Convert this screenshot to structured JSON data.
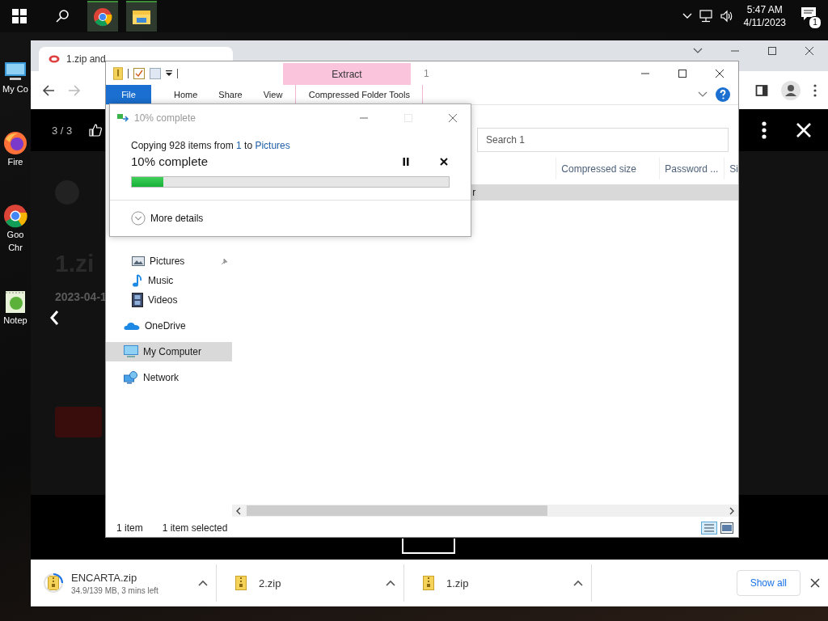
{
  "taskbar": {
    "time": "5:47 AM",
    "date": "4/11/2023",
    "notification_count": "1"
  },
  "desktop_icons": [
    {
      "kind": "computer",
      "label_lines": [
        "My Co"
      ]
    },
    {
      "kind": "firefox",
      "label_lines": [
        "Fire"
      ]
    },
    {
      "kind": "chrome",
      "label_lines": [
        "Goo",
        "Chr"
      ]
    },
    {
      "kind": "notepad",
      "label_lines": [
        "Notep"
      ]
    }
  ],
  "browser": {
    "tab_title": "1.zip and",
    "page": {
      "counter": "3 / 3",
      "title": "1.zi",
      "date": "2023-04-1"
    },
    "downloads": [
      {
        "name": "ENCARTA.zip",
        "status": "34.9/139 MB, 3 mins left",
        "level": 0.25
      },
      {
        "name": "2.zip"
      },
      {
        "name": "1.zip"
      }
    ],
    "show_all": "Show all"
  },
  "explorer": {
    "context_group": "Extract",
    "title": "1",
    "ribbon_tabs": [
      {
        "label": "File",
        "kind": "file"
      },
      {
        "label": "Home",
        "kind": "tab"
      },
      {
        "label": "Share",
        "kind": "tab"
      },
      {
        "label": "View",
        "kind": "tab"
      },
      {
        "label": "Compressed Folder Tools",
        "kind": "context"
      }
    ],
    "search": {
      "placeholder": "Search 1"
    },
    "columns": [
      "Compressed size",
      "Password ...",
      "Si"
    ],
    "rows": [
      {
        "name": "r",
        "selected": true
      }
    ],
    "quick_access": [
      {
        "label": "Pictures",
        "kind": "pictures",
        "pinned": true
      },
      {
        "label": "Music",
        "kind": "music",
        "pinned": false
      },
      {
        "label": "Videos",
        "kind": "videos",
        "pinned": false
      }
    ],
    "locations": [
      {
        "label": "OneDrive",
        "kind": "cloud",
        "selected": false
      },
      {
        "label": "My Computer",
        "kind": "computer",
        "selected": true
      },
      {
        "label": "Network",
        "kind": "network",
        "selected": false
      }
    ],
    "status": {
      "count": "1 item",
      "selection": "1 item selected"
    }
  },
  "copy_dialog": {
    "title": "10% complete",
    "message": {
      "prefix": "Copying 928 items from",
      "source": "1",
      "middle": "to",
      "destination": "Pictures"
    },
    "heading": "10% complete",
    "level": 0.1,
    "more_details": "More details"
  }
}
